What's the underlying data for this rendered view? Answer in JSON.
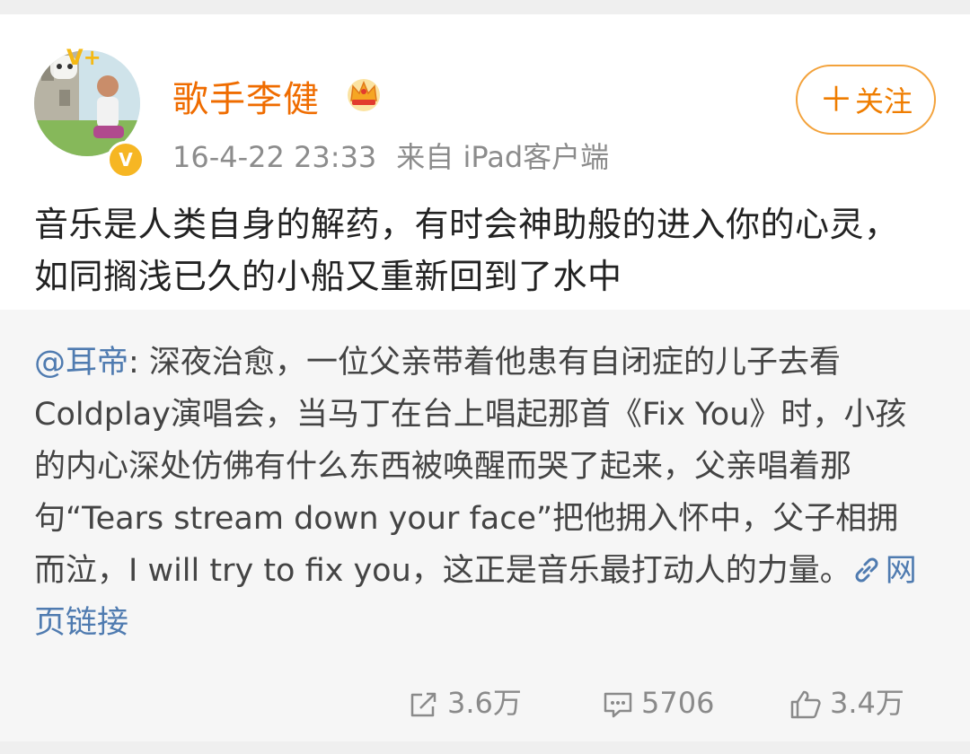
{
  "header": {
    "username": "歌手李健",
    "timestamp": "16-4-22 23:33",
    "source": "来自 iPad客户端",
    "follow_label": "关注",
    "follow_plus": "＋",
    "verified_mark": "V",
    "vip_mark": "V+"
  },
  "post": {
    "text": "音乐是人类自身的解药，有时会神助般的进入你的心灵，如同搁浅已久的小船又重新回到了水中"
  },
  "repost": {
    "mention": "@耳帝",
    "separator": ":",
    "text": " 深夜治愈，一位父亲带着他患有自闭症的儿子去看Coldplay演唱会，当马丁在台上唱起那首《Fix You》时，小孩的内心深处仿佛有什么东西被唤醒而哭了起来，父亲唱着那句“Tears stream down your face”把他拥入怀中，父子相拥而泣，I will try to fix you，这正是音乐最打动人的力量。",
    "link_label": "网页链接"
  },
  "actions": {
    "repost_count": "3.6万",
    "comment_count": "5706",
    "like_count": "3.4万"
  },
  "colors": {
    "username": "#ef6c00",
    "follow_border": "#f3a23b",
    "mention": "#4f7bb0",
    "verified": "#f6b623"
  },
  "icons": {
    "crown": "crown-icon",
    "link": "link-icon",
    "repost": "repost-icon",
    "comment": "comment-icon",
    "like": "like-icon"
  }
}
